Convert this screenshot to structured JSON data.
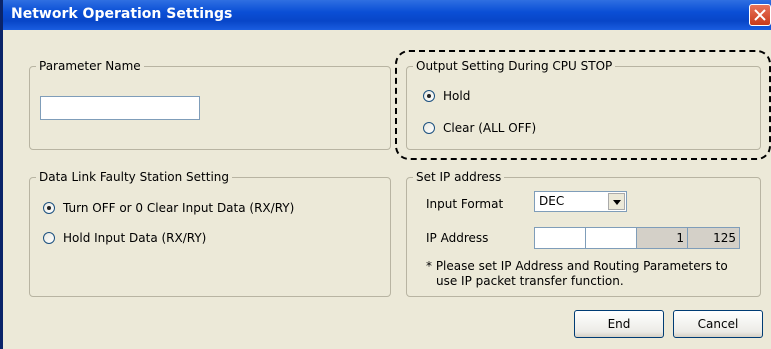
{
  "window": {
    "title": "Network Operation Settings"
  },
  "parameter_name": {
    "legend": "Parameter Name",
    "value": ""
  },
  "output_setting": {
    "legend": "Output Setting During CPU STOP",
    "options": [
      {
        "label": "Hold",
        "checked": true
      },
      {
        "label": "Clear (ALL OFF)",
        "checked": false
      }
    ]
  },
  "data_link": {
    "legend": "Data Link Faulty Station Setting",
    "options": [
      {
        "label": "Turn OFF or 0 Clear Input Data (RX/RY)",
        "checked": true
      },
      {
        "label": "Hold Input Data (RX/RY)",
        "checked": false
      }
    ]
  },
  "ip": {
    "legend": "Set IP address",
    "input_format_label": "Input Format",
    "input_format_value": "DEC",
    "ip_address_label": "IP Address",
    "octets": [
      "",
      "",
      "1",
      "125"
    ],
    "note_line1": "* Please set IP Address and Routing Parameters to",
    "note_line2": "use IP packet transfer function."
  },
  "buttons": {
    "end": "End",
    "cancel": "Cancel"
  }
}
